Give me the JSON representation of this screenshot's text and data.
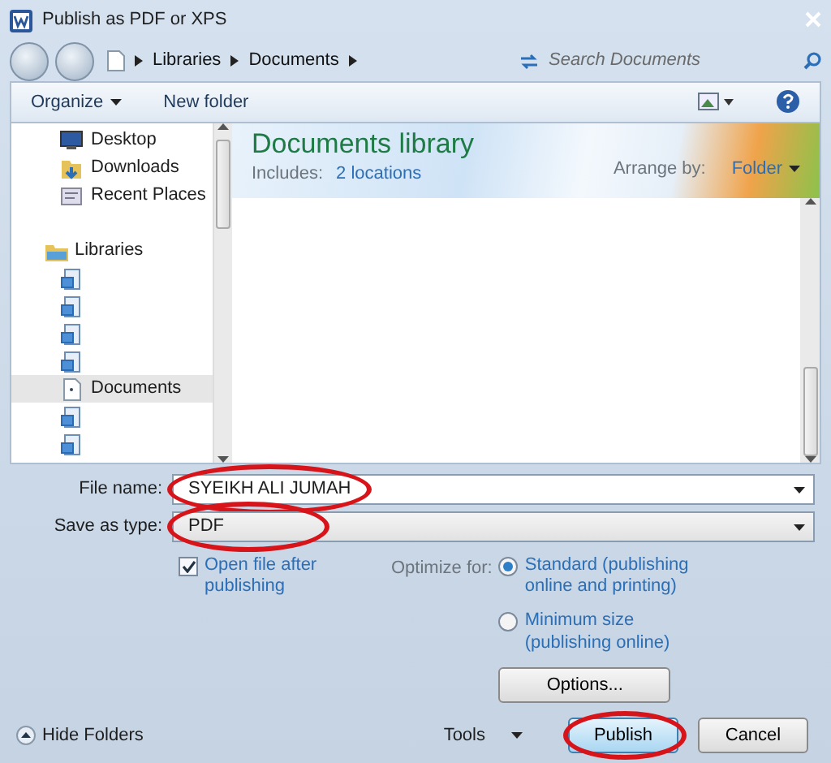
{
  "window": {
    "title": "Publish as PDF or XPS"
  },
  "address_bar": {
    "path": [
      "Libraries",
      "Documents"
    ],
    "search": {
      "placeholder": "Search Documents"
    }
  },
  "toolbar": {
    "organize": "Organize",
    "new_folder": "New folder"
  },
  "sidebar": {
    "items": [
      {
        "kind": "desktop",
        "label": "Desktop",
        "selected": false
      },
      {
        "kind": "downloads",
        "label": "Downloads",
        "selected": false
      },
      {
        "kind": "recent",
        "label": "Recent Places",
        "selected": false
      },
      {
        "kind": "gap"
      },
      {
        "kind": "libraries",
        "label": "Libraries",
        "selected": false
      },
      {
        "kind": "library",
        "selected": false
      },
      {
        "kind": "library",
        "selected": false
      },
      {
        "kind": "library",
        "selected": false
      },
      {
        "kind": "library",
        "selected": false
      },
      {
        "kind": "document",
        "label": "Documents",
        "selected": true
      },
      {
        "kind": "library",
        "selected": false
      },
      {
        "kind": "library",
        "selected": false
      }
    ]
  },
  "library": {
    "title": "Documents library",
    "includes_label": "Includes:",
    "includes_link": "2 locations",
    "arrange_label": "Arrange by:",
    "arrange_value": "Folder"
  },
  "form": {
    "file_name": {
      "label": "File name:",
      "value": "SYEIKH ALI JUMAH",
      "circled": true
    },
    "save_as_type": {
      "label": "Save as type:",
      "value": "PDF",
      "circled": true
    }
  },
  "options": {
    "open_after": {
      "label": "Open file after publishing",
      "checked": true
    },
    "optimize_label": "Optimize for:",
    "optimize": [
      {
        "label": "Standard (publishing online and printing)",
        "selected": true
      },
      {
        "label": "Minimum size (publishing online)",
        "selected": false
      }
    ],
    "options_button": "Options..."
  },
  "footer": {
    "hide_folders": "Hide Folders",
    "tools": "Tools",
    "buttons": [
      {
        "label": "Publish",
        "kind": "primary",
        "circled": true
      },
      {
        "label": "Cancel",
        "kind": "secondary",
        "circled": false
      }
    ]
  }
}
